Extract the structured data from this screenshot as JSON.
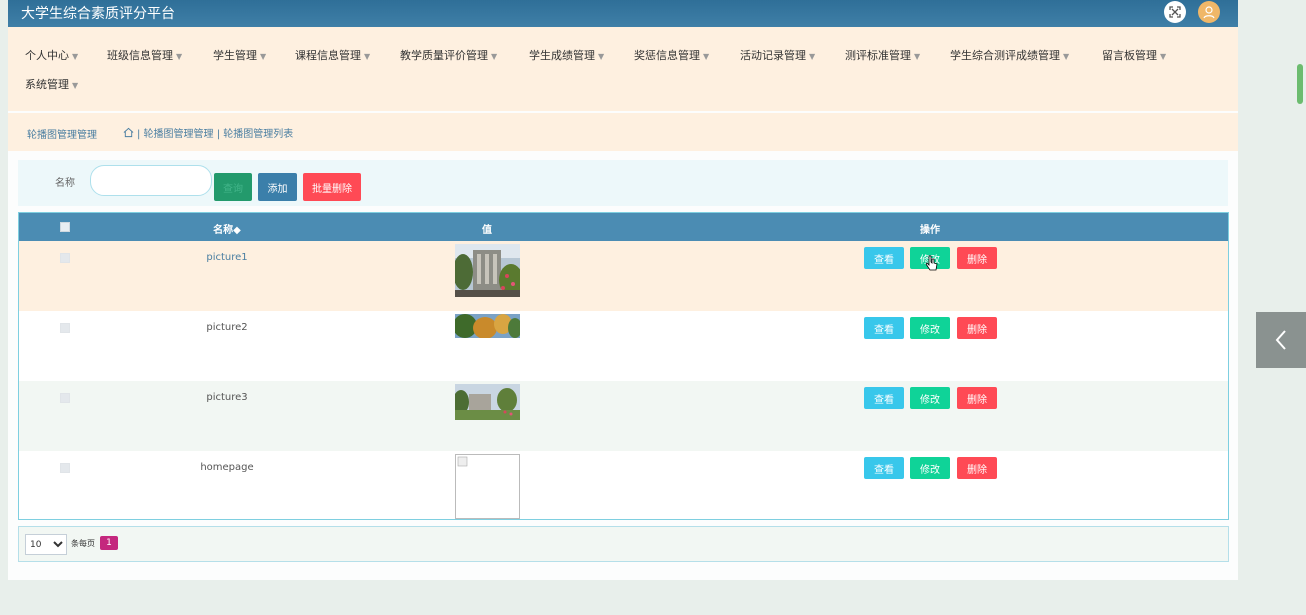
{
  "header": {
    "title": "大学生综合素质评分平台",
    "fullscreen_icon": "fullscreen-icon",
    "avatar_icon": "user-avatar-icon"
  },
  "nav": {
    "items": [
      {
        "label": "个人中心"
      },
      {
        "label": "班级信息管理"
      },
      {
        "label": "学生管理"
      },
      {
        "label": "课程信息管理"
      },
      {
        "label": "教学质量评价管理"
      },
      {
        "label": "学生成绩管理"
      },
      {
        "label": "奖惩信息管理"
      },
      {
        "label": "活动记录管理"
      },
      {
        "label": "测评标准管理"
      },
      {
        "label": "学生综合测评成绩管理"
      },
      {
        "label": "留言板管理"
      },
      {
        "label": "系统管理"
      }
    ]
  },
  "breadcrumb": {
    "title": "轮播图管理管理",
    "path": "| 轮播图管理管理 | 轮播图管理列表"
  },
  "search": {
    "label": "名称",
    "value": "",
    "search_button": "查询",
    "add_button": "添加",
    "batch_delete_button": "批量删除"
  },
  "table": {
    "headers": {
      "name": "名称◆",
      "value": "值",
      "actions": "操作"
    },
    "rows": [
      {
        "name": "picture1"
      },
      {
        "name": "picture2"
      },
      {
        "name": "picture3"
      },
      {
        "name": "homepage"
      }
    ],
    "actions": {
      "view": "查看",
      "edit": "修改",
      "delete": "删除"
    }
  },
  "pagination": {
    "page_size": "10",
    "page_size_options": [
      "10"
    ],
    "per_page_label": "条每页",
    "current_page": "1"
  },
  "colors": {
    "header_bg": "#3f7fa7",
    "nav_bg": "#fef0e0",
    "table_head": "#4b8cb3",
    "view": "#38c7eb",
    "edit": "#0fd398",
    "delete": "#ff4a55",
    "page_active": "#c4287e"
  }
}
